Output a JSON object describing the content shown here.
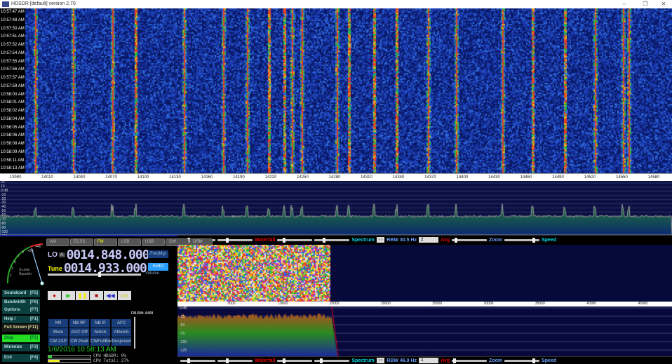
{
  "window": {
    "title": "HDSDR [default]  version 2.70",
    "minimize": "–",
    "restore": "❐",
    "close": "✕"
  },
  "waterfall": {
    "times": [
      "10:57:47 AM",
      "10:57:48 AM",
      "10:57:50 AM",
      "10:57:51 AM",
      "10:57:52 AM",
      "10:57:54 AM",
      "10:57:55 AM",
      "10:57:56 AM",
      "10:57:57 AM",
      "10:57:59 AM",
      "10:58:00 AM",
      "10:58:01 AM",
      "10:58:02 AM",
      "10:58:04 AM",
      "10:58:05 AM",
      "10:58:06 AM",
      "10:58:08 AM",
      "10:58:09 AM",
      "10:58:11 AM",
      "10:58:13 AM"
    ]
  },
  "freq_axis": [
    "13980",
    "14010",
    "14040",
    "14070",
    "14100",
    "14130",
    "14160",
    "14190",
    "14220",
    "14250",
    "14280",
    "14310",
    "14340",
    "14370",
    "14400",
    "14430",
    "14460",
    "14490",
    "14520",
    "14550",
    "14580"
  ],
  "spectrum": {
    "db_labels": [
      "20",
      "10",
      "0 dB",
      "-10",
      "-20",
      "-30",
      "-40",
      "-50",
      "-60",
      "-70",
      "-80",
      "-90",
      "-100",
      "-110"
    ]
  },
  "rf_bar": {
    "waterfall": "Waterfall",
    "spectrum": "Spectrum",
    "rbw": "RBW 30.5 Hz",
    "avg_value": "2",
    "avg": "Avg",
    "zoom": "Zoom",
    "speed": "Speed"
  },
  "af_bar": {
    "waterfall": "Waterfall",
    "spectrum": "Spectrum",
    "rbw": "RBW 46.9 Hz",
    "avg_value": "1",
    "avg": "Avg",
    "zoom": "Zoom",
    "speed": "Speed"
  },
  "smeter": {
    "label1": "S-units",
    "label2": "Squelch",
    "scale": [
      "1",
      "3",
      "5",
      "7",
      "9",
      "+20",
      "+40"
    ]
  },
  "modes": [
    {
      "label": "AM",
      "on": false
    },
    {
      "label": "ECSS",
      "on": false
    },
    {
      "label": "FM",
      "on": true
    },
    {
      "label": "LSB",
      "on": false
    },
    {
      "label": "USB",
      "on": false
    },
    {
      "label": "CW",
      "on": false
    },
    {
      "label": "DRM",
      "on": false
    }
  ],
  "lo": {
    "label": "LO",
    "sub": "A",
    "value": "0014.848.000"
  },
  "tune": {
    "label": "Tune",
    "value": "0014.933.000"
  },
  "freqmgr": "FreqMgr",
  "extio": "ExtIO",
  "volume": "Volume",
  "side_buttons": [
    {
      "label": "Soundcard",
      "key": "[F5]"
    },
    {
      "label": "Bandwidth",
      "key": "[F6]"
    },
    {
      "label": "Options",
      "key": "[F7]"
    },
    {
      "label": "Help / Update",
      "key": "[F1]"
    },
    {
      "label": "Full Screen",
      "key": "[F11]"
    },
    {
      "label": "Stop",
      "key": "[F2]"
    },
    {
      "label": "Minimize",
      "key": "[F3]"
    },
    {
      "label": "Exit",
      "key": "[F4]"
    }
  ],
  "transport": [
    "●",
    "▶",
    "❚❚",
    "■",
    "◀◀",
    "oo"
  ],
  "dsp": [
    [
      "NR",
      "NB RF",
      "NB IF",
      "AFC"
    ],
    [
      "Mute",
      "AGC Off",
      "Notch",
      "ANotch"
    ],
    [
      "CW ZAP",
      "CW Peak",
      "CWFullBw",
      "Despread"
    ]
  ],
  "fm_bw": "FM-BW: 8409",
  "datetime": "1/6/2016 10:58:13 AM",
  "cpu": {
    "hdsdr": "CPU HDSDR:  9%",
    "total": "CPU Total: 27%"
  },
  "audio_axis": [
    "5000",
    "10000",
    "15000",
    "20000",
    "25000",
    "30000",
    "35000",
    "40000",
    "45000"
  ],
  "audio_db": [
    "0 dB",
    "-25",
    "-50",
    "-75",
    "-100",
    "-125"
  ],
  "colors": {
    "stop_active": "#22dd22",
    "freq_digits": "#c8c8f8",
    "tune_label": "#ffff00",
    "datetime": "#22cc22"
  }
}
